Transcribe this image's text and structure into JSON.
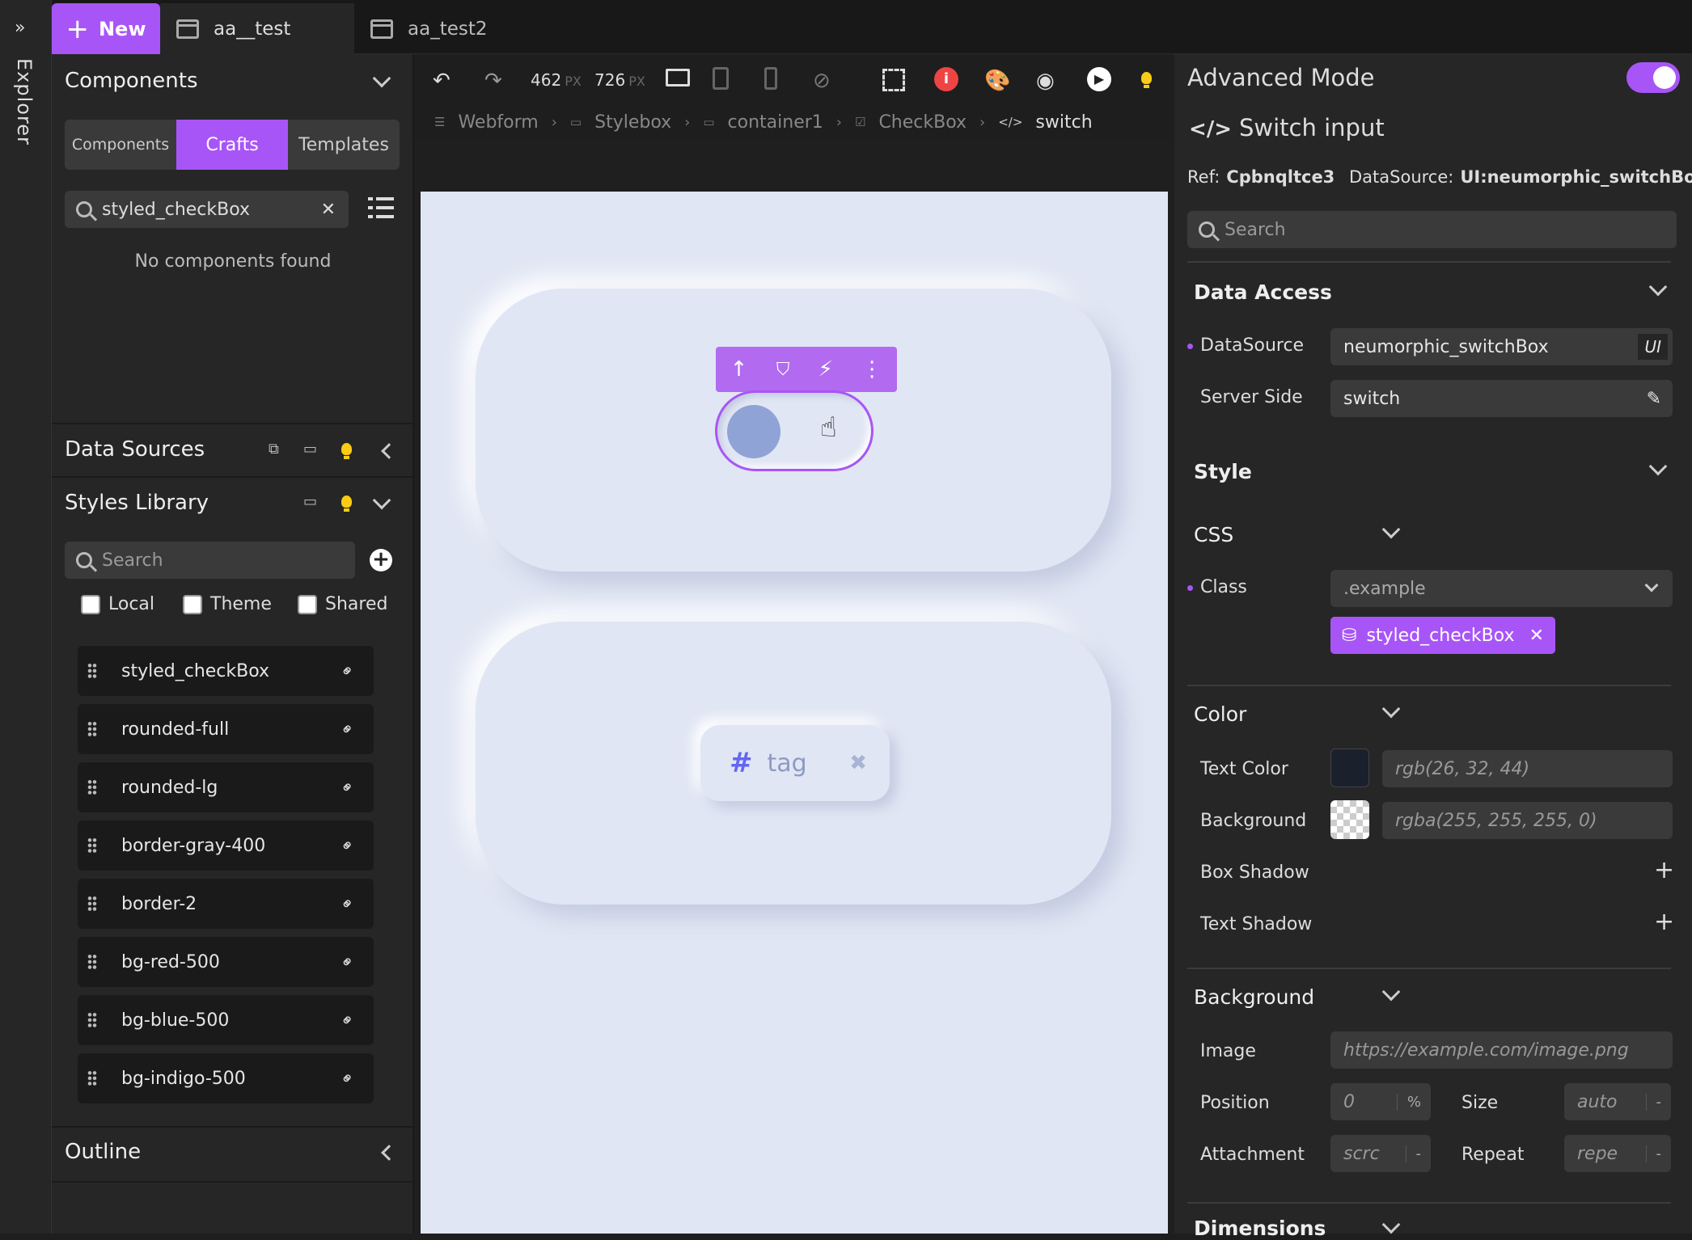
{
  "explorer": {
    "label": "Explorer",
    "expand_glyph": "»"
  },
  "tabs": {
    "new_label": "New",
    "items": [
      {
        "label": "aa__test"
      },
      {
        "label": "aa_test2"
      }
    ]
  },
  "components_panel": {
    "title": "Components",
    "segments": [
      "Components",
      "Crafts",
      "Templates"
    ],
    "active_segment": "Crafts",
    "search_value": "styled_checkBox",
    "empty_text": "No components found"
  },
  "data_sources": {
    "title": "Data Sources"
  },
  "styles_library": {
    "title": "Styles Library",
    "search_placeholder": "Search",
    "filters": [
      "Local",
      "Theme",
      "Shared"
    ],
    "items": [
      "styled_checkBox",
      "rounded-full",
      "rounded-lg",
      "border-gray-400",
      "border-2",
      "bg-red-500",
      "bg-blue-500",
      "bg-indigo-500"
    ]
  },
  "outline": {
    "title": "Outline"
  },
  "toolbar": {
    "width": "462",
    "height": "726",
    "unit": "PX"
  },
  "breadcrumb": [
    "Webform",
    "Stylebox",
    "container1",
    "CheckBox",
    "switch"
  ],
  "canvas": {
    "tag_label": "tag"
  },
  "right_panel": {
    "mode_title": "Advanced Mode",
    "component_title": "Switch input",
    "ref_label": "Ref:",
    "ref_value": "Cpbnqltce3",
    "ds_label": "DataSource:",
    "ds_value": "UI:neumorphic_switchBox",
    "search_placeholder": "Search",
    "data_access": {
      "title": "Data Access",
      "datasource_label": "DataSource",
      "datasource_value": "neumorphic_switchBox",
      "datasource_badge": "UI",
      "server_side_label": "Server Side",
      "server_side_value": "switch"
    },
    "style": {
      "title": "Style",
      "css_title": "CSS",
      "class_label": "Class",
      "class_value": ".example",
      "chip_label": "styled_checkBox"
    },
    "color": {
      "title": "Color",
      "text_color_label": "Text Color",
      "text_color_value": "rgb(26, 32, 44)",
      "background_label": "Background",
      "background_value": "rgba(255, 255, 255, 0)",
      "box_shadow_label": "Box Shadow",
      "text_shadow_label": "Text Shadow"
    },
    "background": {
      "title": "Background",
      "image_label": "Image",
      "image_placeholder": "https://example.com/image.png",
      "position_label": "Position",
      "position_value": "0",
      "position_unit": "%",
      "size_label": "Size",
      "size_value": "auto",
      "size_unit": "-",
      "attachment_label": "Attachment",
      "attachment_value": "scrc",
      "attachment_unit": "-",
      "repeat_label": "Repeat",
      "repeat_value": "repe",
      "repeat_unit": "-"
    },
    "dimensions_title": "Dimensions"
  },
  "colors": {
    "accent": "#a855f7",
    "canvas": "#e0e6f3",
    "text_color_swatch": "#1a202c"
  }
}
